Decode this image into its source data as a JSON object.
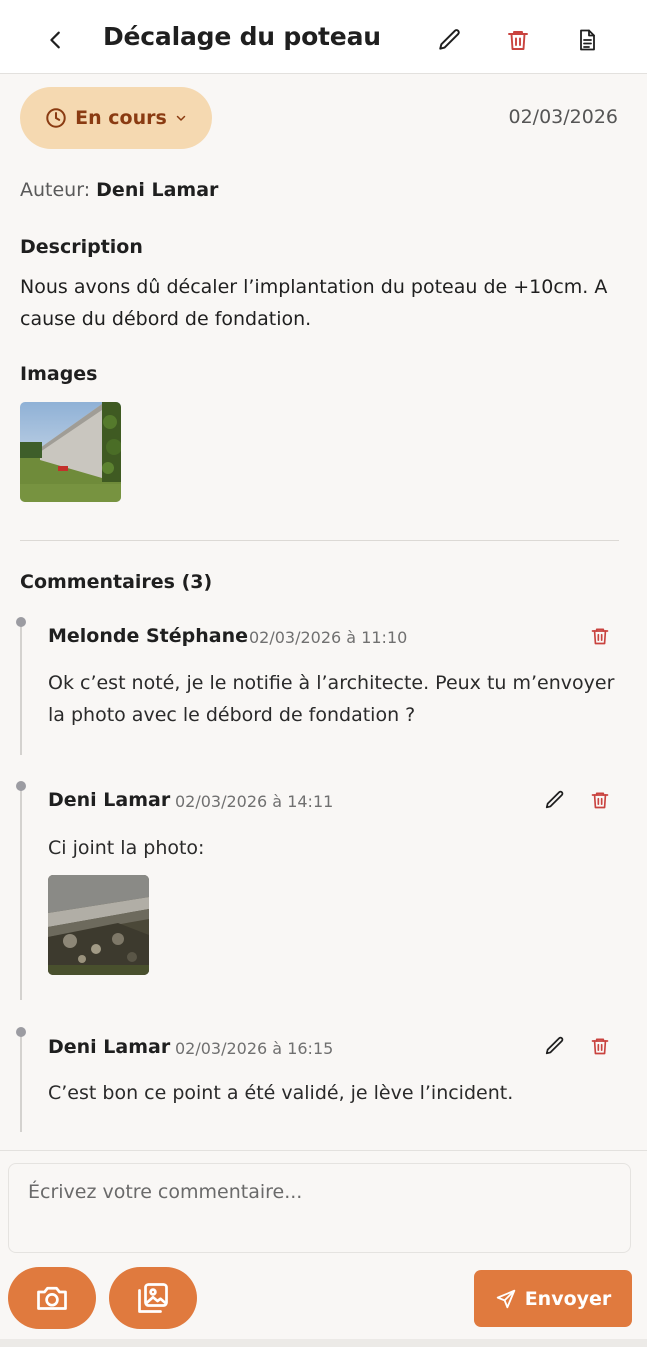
{
  "header": {
    "title": "Décalage du poteau",
    "icons": {
      "back": "chevron-left-icon",
      "edit": "pencil-icon",
      "delete": "trash-icon",
      "report": "document-icon"
    }
  },
  "status": {
    "label": "En cours",
    "icon": "clock-icon",
    "color": "#8a3b12",
    "background": "#f5d9b1"
  },
  "date": "02/03/2026",
  "author": {
    "label": "Auteur:",
    "name": "Deni Lamar"
  },
  "description": {
    "heading": "Description",
    "text": "Nous avons dû décaler l’implantation du poteau de +10cm. A cause du débord de fondation."
  },
  "images": {
    "heading": "Images"
  },
  "comments": {
    "heading": "Commentaires (3)",
    "items": [
      {
        "author": "Melonde Stéphane",
        "date": "02/03/2026 à 11:10",
        "text": "Ok c’est noté, je le notifie à l’architecte. Peux tu m’envoyer la photo avec le débord de fondation ?"
      },
      {
        "author": "Deni Lamar",
        "date": "02/03/2026 à 14:11",
        "text": "Ci joint la photo:"
      },
      {
        "author": "Deni Lamar",
        "date": "02/03/2026 à 16:15",
        "text": "C’est bon ce point a été validé, je lève l’incident."
      }
    ]
  },
  "composer": {
    "placeholder": "Écrivez votre commentaire...",
    "send_label": "Envoyer"
  },
  "colors": {
    "accent": "#e07a3e",
    "danger": "#c9433f"
  }
}
